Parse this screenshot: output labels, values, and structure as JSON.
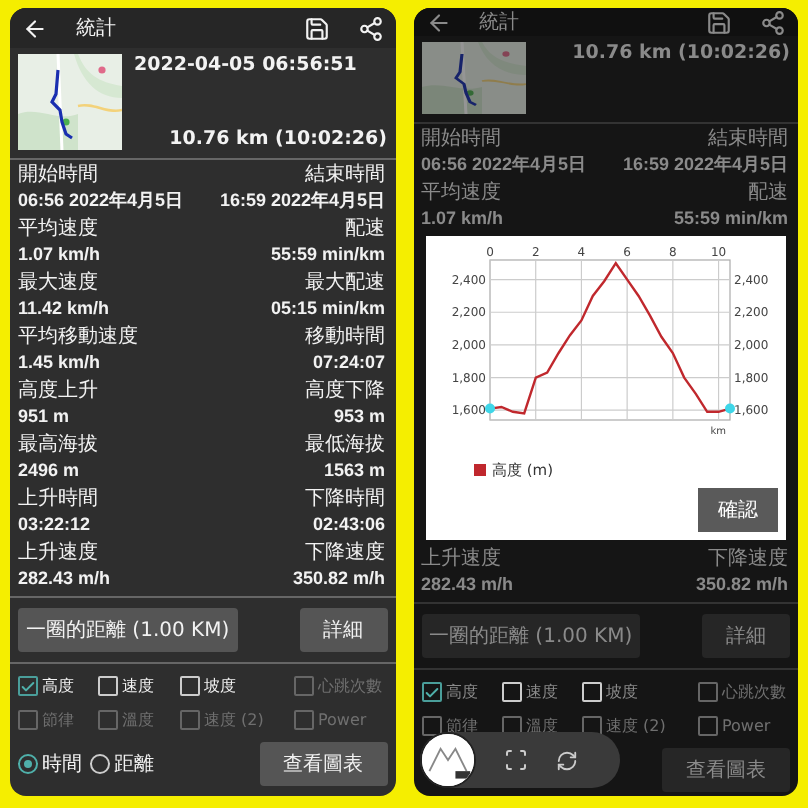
{
  "panels": [
    {
      "dimmed": false,
      "header": {
        "title": "統計"
      },
      "summary": {
        "date": "2022-04-05 06:56:51",
        "distance": "10.76 km (10:02:26)"
      },
      "stats_top": [
        {
          "left_label": "開始時間",
          "left_value": "06:56 2022年4月5日",
          "right_label": "結束時間",
          "right_value": "16:59 2022年4月5日"
        },
        {
          "left_label": "平均速度",
          "left_value": "1.07 km/h",
          "right_label": "配速",
          "right_value": "55:59 min/km"
        },
        {
          "left_label": "最大速度",
          "left_value": "11.42 km/h",
          "right_label": "最大配速",
          "right_value": "05:15 min/km"
        },
        {
          "left_label": "平均移動速度",
          "left_value": "1.45 km/h",
          "right_label": "移動時間",
          "right_value": "07:24:07"
        },
        {
          "left_label": "高度上升",
          "left_value": "951 m",
          "right_label": "高度下降",
          "right_value": "953 m"
        },
        {
          "left_label": "最高海拔",
          "left_value": "2496 m",
          "right_label": "最低海拔",
          "right_value": "1563 m"
        },
        {
          "left_label": "上升時間",
          "left_value": "03:22:12",
          "right_label": "下降時間",
          "right_value": "02:43:06"
        },
        {
          "left_label": "上升速度",
          "left_value": "282.43 m/h",
          "right_label": "下降速度",
          "right_value": "350.82 m/h"
        }
      ],
      "lap_button": "一圈的距離 (1.00  KM)",
      "details_button": "詳細",
      "series_toggles": [
        {
          "label": "高度",
          "checked": true,
          "disabled": false
        },
        {
          "label": "速度",
          "checked": false,
          "disabled": false
        },
        {
          "label": "坡度",
          "checked": false,
          "disabled": false
        },
        {
          "label": "心跳次數",
          "checked": false,
          "disabled": true
        },
        {
          "label": "節律",
          "checked": false,
          "disabled": true
        },
        {
          "label": "溫度",
          "checked": false,
          "disabled": true
        },
        {
          "label": "速度 (2)",
          "checked": false,
          "disabled": true
        },
        {
          "label": "Power",
          "checked": false,
          "disabled": true
        }
      ],
      "axis_options": [
        {
          "label": "時間",
          "selected": true
        },
        {
          "label": "距離",
          "selected": false
        }
      ],
      "chart_button": "查看圖表"
    },
    {
      "dimmed": true,
      "header": {
        "title": "統計"
      },
      "summary": {
        "distance": "10.76 km (10:02:26)"
      },
      "stats_top": [
        {
          "left_label": "開始時間",
          "left_value": "06:56 2022年4月5日",
          "right_label": "結束時間",
          "right_value": "16:59 2022年4月5日"
        },
        {
          "left_label": "平均速度",
          "left_value": "1.07 km/h",
          "right_label": "配速",
          "right_value": "55:59 min/km"
        }
      ],
      "dialog": {
        "confirm_button": "確認",
        "chart_data": {
          "type": "line",
          "grid": true,
          "xlabel": "km",
          "xlim": [
            0,
            10.5
          ],
          "ylim": [
            1540,
            2520
          ],
          "xticks": [
            0,
            2,
            4,
            6,
            8,
            10
          ],
          "yticks": [
            {
              "value": 1600,
              "label": "1,600"
            },
            {
              "value": 1800,
              "label": "1,800"
            },
            {
              "value": 2000,
              "label": "2,000"
            },
            {
              "value": 2200,
              "label": "2,200"
            },
            {
              "value": 2400,
              "label": "2,400"
            }
          ],
          "x": [
            0,
            0.5,
            1,
            1.5,
            2,
            2.5,
            3,
            3.5,
            4,
            4.5,
            5,
            5.5,
            6,
            6.5,
            7,
            7.5,
            8,
            8.5,
            9,
            9.5,
            10,
            10.5
          ],
          "series": [
            {
              "name": "高度 (m)",
              "color": "#c0282d",
              "values": [
                1610,
                1620,
                1590,
                1580,
                1800,
                1830,
                1950,
                2060,
                2150,
                2300,
                2390,
                2500,
                2400,
                2300,
                2180,
                2050,
                1950,
                1800,
                1700,
                1590,
                1590,
                1610
              ]
            }
          ]
        }
      },
      "stats_bottom": [
        {
          "left_label": "上升速度",
          "left_value": "282.43 m/h",
          "right_label": "下降速度",
          "right_value": "350.82 m/h"
        }
      ],
      "lap_button": "一圈的距離 (1.00  KM)",
      "details_button": "詳細",
      "series_toggles": [
        {
          "label": "高度",
          "checked": true,
          "disabled": false
        },
        {
          "label": "速度",
          "checked": false,
          "disabled": false
        },
        {
          "label": "坡度",
          "checked": false,
          "disabled": false
        },
        {
          "label": "心跳次數",
          "checked": false,
          "disabled": true
        },
        {
          "label": "節律",
          "checked": false,
          "disabled": true
        },
        {
          "label": "溫度",
          "checked": false,
          "disabled": true
        },
        {
          "label": "速度 (2)",
          "checked": false,
          "disabled": true
        },
        {
          "label": "Power",
          "checked": false,
          "disabled": true
        }
      ],
      "capture_toolbar": true,
      "chart_button": "查看圖表"
    }
  ]
}
